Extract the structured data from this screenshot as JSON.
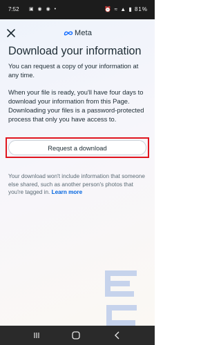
{
  "status_bar": {
    "time": "7:52",
    "battery": "81%"
  },
  "header": {
    "brand": "Meta"
  },
  "title": "Download your information",
  "intro": "You can request a copy of your information at any time.",
  "description": "When your file is ready, you'll have four days to download your information from this Page. Downloading your files is a password-protected process that only you have access to.",
  "request_button": "Request a download",
  "note": {
    "text": "Your download won't include information that someone else shared, such as another person's photos that you're tagged in.",
    "link": "Learn more"
  },
  "colors": {
    "highlight": "#e0141e",
    "link": "#0064e0",
    "text": "#1c2b33"
  }
}
